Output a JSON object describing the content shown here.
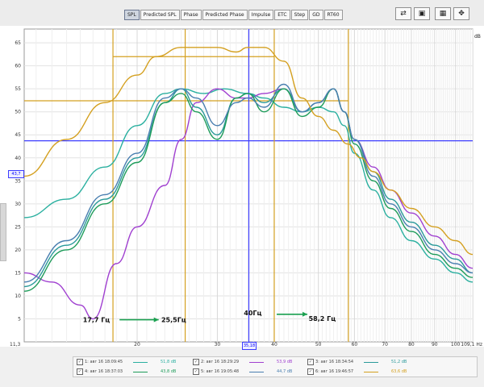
{
  "toolbar": {
    "tabs": [
      "SPL",
      "Predicted SPL",
      "Phase",
      "Predicted Phase",
      "Impulse",
      "ETC",
      "Step",
      "GD",
      "RT60"
    ],
    "active_tab": "SPL"
  },
  "plot": {
    "ylabel": "dB",
    "y_ticks": [
      "65",
      "60",
      "55",
      "50",
      "45",
      "40",
      "35",
      "30",
      "25",
      "20",
      "15",
      "10",
      "5"
    ],
    "x_ticks": [
      "11,3",
      "20",
      "30",
      "40",
      "50",
      "60",
      "70",
      "80",
      "90",
      "100",
      "109,1 Hz"
    ],
    "cursor_x_readout": "35,18",
    "cursor_y_readout": "43,7"
  },
  "annotations": {
    "left_pair_low": "17,7 Гц",
    "left_pair_high": "25,5Гц",
    "right_pair_low": "40Гц",
    "right_pair_high": "58,2 Гц"
  },
  "legend": {
    "items": [
      {
        "name": "1: авг 16 18:09:45",
        "value": "51,8 dB",
        "color": "#2bb0a0"
      },
      {
        "name": "2: авг 16 18:29:29",
        "value": "53,9 dB",
        "color": "#a040d0"
      },
      {
        "name": "3: авг 16 18:34:54",
        "value": "51,2 dB",
        "color": "#2a9a9a"
      },
      {
        "name": "4: авг 16 18:37:03",
        "value": "43,8 dB",
        "color": "#1e9c5a"
      },
      {
        "name": "5: авг 16 19:05:48",
        "value": "44,7 dB",
        "color": "#4a7fb0"
      },
      {
        "name": "6: авг 16 19:46:57",
        "value": "63,6 dB",
        "color": "#d4a020"
      }
    ]
  },
  "chart_data": {
    "type": "line",
    "ylabel": "dB",
    "ylim": [
      0,
      68
    ],
    "xlim": [
      11.3,
      109.1
    ],
    "xscale": "log",
    "grid": true,
    "series": [
      {
        "name": "1: авг 16 18:09:45",
        "color": "#2bb0a0",
        "x": [
          11.3,
          14,
          17,
          20,
          23,
          25,
          28,
          31,
          35,
          38,
          42,
          46,
          50,
          54,
          57,
          60,
          66,
          72,
          80,
          90,
          100,
          109.1
        ],
        "y": [
          27,
          31,
          38,
          47,
          54,
          55,
          54,
          55,
          54,
          53,
          51,
          50,
          51,
          50,
          47,
          41,
          33,
          27,
          22,
          18,
          15,
          13
        ]
      },
      {
        "name": "2: авг 16 18:29:29",
        "color": "#a040d0",
        "x": [
          11.3,
          13,
          15,
          16,
          18,
          20,
          23,
          25,
          27,
          30,
          33,
          35,
          38,
          42,
          46,
          50,
          54,
          57,
          60,
          66,
          72,
          80,
          90,
          100,
          109.1
        ],
        "y": [
          15,
          13,
          8,
          5,
          17,
          25,
          34,
          44,
          52,
          55,
          53,
          53,
          54,
          55,
          50,
          52,
          55,
          50,
          44,
          38,
          33,
          28,
          23,
          19,
          16
        ]
      },
      {
        "name": "3: авг 16 18:34:54",
        "color": "#2a9a9a",
        "x": [
          11.3,
          14,
          17,
          20,
          23,
          25,
          27,
          30,
          33,
          35,
          38,
          42,
          46,
          50,
          54,
          57,
          60,
          66,
          72,
          80,
          90,
          100,
          109.1
        ],
        "y": [
          12,
          21,
          31,
          40,
          52,
          55,
          51,
          45,
          53,
          54,
          52,
          55,
          50,
          52,
          55,
          50,
          44,
          37,
          31,
          26,
          21,
          18,
          15
        ]
      },
      {
        "name": "4: авг 16 18:37:03",
        "color": "#1e9c5a",
        "x": [
          11.3,
          14,
          17,
          20,
          23,
          25,
          27,
          30,
          33,
          35,
          38,
          42,
          46,
          50,
          54,
          57,
          60,
          66,
          72,
          80,
          90,
          100,
          109.1
        ],
        "y": [
          11,
          20,
          30,
          39,
          52,
          54,
          50,
          44,
          53,
          54,
          50,
          55,
          49,
          51,
          55,
          50,
          43,
          35,
          29,
          24,
          19,
          16,
          14
        ]
      },
      {
        "name": "5: авг 16 19:05:48",
        "color": "#4a7fb0",
        "x": [
          11.3,
          14,
          17,
          20,
          23,
          25,
          27,
          30,
          33,
          35,
          38,
          42,
          46,
          50,
          54,
          57,
          60,
          66,
          72,
          80,
          90,
          100,
          109.1
        ],
        "y": [
          13,
          22,
          32,
          41,
          53,
          55,
          53,
          47,
          52,
          53,
          51,
          56,
          50,
          52,
          55,
          50,
          44,
          36,
          30,
          25,
          20,
          17,
          15
        ]
      },
      {
        "name": "6: авг 16 19:46:57",
        "color": "#d4a020",
        "x": [
          11.3,
          14,
          17,
          20,
          22,
          25,
          30,
          33,
          35,
          38,
          42,
          46,
          50,
          54,
          58,
          62,
          66,
          72,
          80,
          90,
          100,
          109.1
        ],
        "y": [
          36,
          44,
          52,
          58,
          62,
          64,
          64,
          63,
          64,
          64,
          61,
          53,
          49,
          46,
          43,
          40,
          37,
          33,
          29,
          25,
          22,
          19
        ]
      }
    ],
    "hlines": [
      {
        "y": 62,
        "x_range": [
          17.7,
          40
        ],
        "color": "#d4a020"
      },
      {
        "y": 52.4,
        "x_range": [
          11.3,
          58.2
        ],
        "color": "#d4a020"
      },
      {
        "y": 43.7,
        "x_range": [
          11.3,
          109.1
        ],
        "color": "#3c3cff"
      }
    ],
    "vlines": [
      {
        "x": 17.7,
        "color": "#d4a020"
      },
      {
        "x": 25.5,
        "color": "#d4a020"
      },
      {
        "x": 40,
        "color": "#d4a020"
      },
      {
        "x": 58.2,
        "color": "#d4a020"
      },
      {
        "x": 35.18,
        "color": "#3c3cff"
      }
    ]
  }
}
